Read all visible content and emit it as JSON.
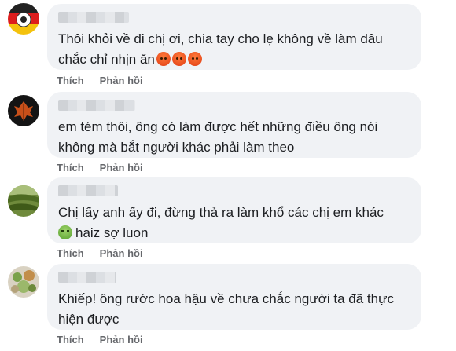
{
  "actions": {
    "like": "Thích",
    "reply": "Phản hồi"
  },
  "comments": [
    {
      "text": "Thôi khỏi về đi chị ơi, chia tay cho lẹ không về làm dâu\nchắc chỉ nhịn ăn",
      "emojis": [
        "angry-face-icon",
        "angry-face-icon",
        "angry-face-icon"
      ]
    },
    {
      "text": "em tém thôi, ông có làm được hết những điều ông nói\nkhông mà bắt người khác phải làm theo"
    },
    {
      "text": "Chị lấy anh ấy đi, đừng thả ra làm khổ các chị em khác",
      "emoji_line": "haiz sợ luon"
    },
    {
      "text": "Khiếp! ông rước hoa hậu về chưa chắc người ta đã thực\nhiện được"
    }
  ]
}
